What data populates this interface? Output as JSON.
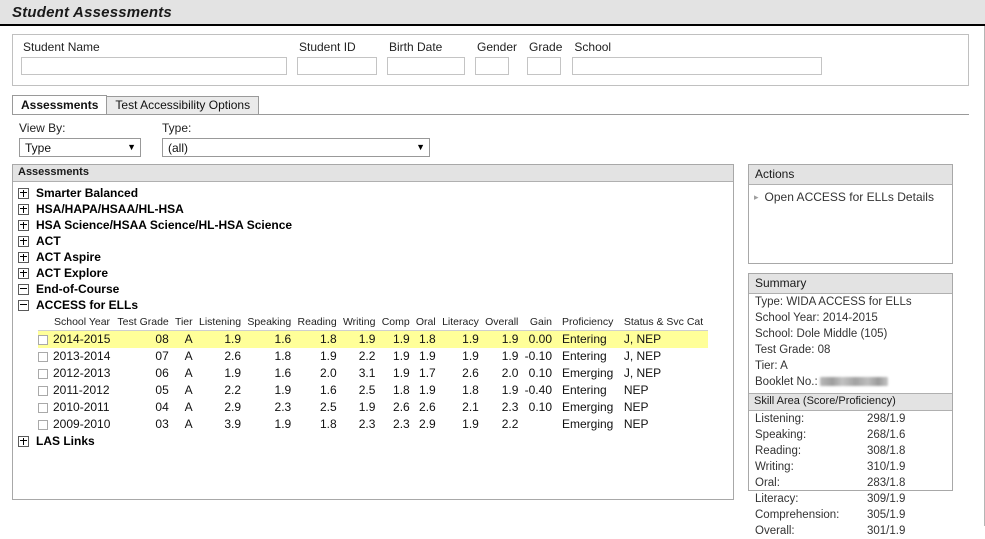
{
  "page_title": "Student Assessments",
  "criteria": {
    "fields": [
      {
        "label": "Student Name",
        "value": "",
        "placeholder": ""
      },
      {
        "label": "Student ID",
        "value": "",
        "placeholder": ""
      },
      {
        "label": "Birth Date",
        "value": "",
        "placeholder": ""
      },
      {
        "label": "Gender",
        "value": "",
        "placeholder": ""
      },
      {
        "label": "Grade",
        "value": "",
        "placeholder": ""
      },
      {
        "label": "School",
        "value": "",
        "placeholder": ""
      }
    ]
  },
  "tabs": [
    {
      "label": "Assessments",
      "active": true
    },
    {
      "label": "Test Accessibility Options",
      "active": false
    }
  ],
  "filters": {
    "view_by_label": "View By:",
    "view_by_value": "Type",
    "type_label": "Type:",
    "type_value": "(all)",
    "caret": "▼"
  },
  "assessments_panel": {
    "header": "Assessments",
    "tree": [
      {
        "label": "Smarter Balanced",
        "expanded": false
      },
      {
        "label": "HSA/HAPA/HSAA/HL-HSA",
        "expanded": false
      },
      {
        "label": "HSA Science/HSAA Science/HL-HSA Science",
        "expanded": false
      },
      {
        "label": "ACT",
        "expanded": false
      },
      {
        "label": "ACT Aspire",
        "expanded": false
      },
      {
        "label": "ACT Explore",
        "expanded": false
      },
      {
        "label": "End-of-Course",
        "expanded": true
      },
      {
        "label": "ACCESS for ELLs",
        "expanded": true
      },
      {
        "label": "LAS Links",
        "expanded": false
      }
    ]
  },
  "scores_table": {
    "columns": [
      "School Year",
      "Test Grade",
      "Tier",
      "Listening",
      "Speaking",
      "Reading",
      "Writing",
      "Comp",
      "Oral",
      "Literacy",
      "Overall",
      "Gain",
      "Proficiency",
      "Status & Svc Cat"
    ],
    "rows": [
      {
        "selected": true,
        "school_year": "2014-2015",
        "test_grade": "08",
        "tier": "A",
        "listening": "1.9",
        "speaking": "1.6",
        "reading": "1.8",
        "writing": "1.9",
        "comp": "1.9",
        "oral": "1.8",
        "literacy": "1.9",
        "overall": "1.9",
        "gain": "0.00",
        "proficiency": "Entering",
        "status_svc_cat": "J, NEP"
      },
      {
        "selected": false,
        "school_year": "2013-2014",
        "test_grade": "07",
        "tier": "A",
        "listening": "2.6",
        "speaking": "1.8",
        "reading": "1.9",
        "writing": "2.2",
        "comp": "1.9",
        "oral": "1.9",
        "literacy": "1.9",
        "overall": "1.9",
        "gain": "-0.10",
        "proficiency": "Entering",
        "status_svc_cat": "J, NEP"
      },
      {
        "selected": false,
        "school_year": "2012-2013",
        "test_grade": "06",
        "tier": "A",
        "listening": "1.9",
        "speaking": "1.6",
        "reading": "2.0",
        "writing": "3.1",
        "comp": "1.9",
        "oral": "1.7",
        "literacy": "2.6",
        "overall": "2.0",
        "gain": "0.10",
        "proficiency": "Emerging",
        "status_svc_cat": "J, NEP"
      },
      {
        "selected": false,
        "school_year": "2011-2012",
        "test_grade": "05",
        "tier": "A",
        "listening": "2.2",
        "speaking": "1.9",
        "reading": "1.6",
        "writing": "2.5",
        "comp": "1.8",
        "oral": "1.9",
        "literacy": "1.8",
        "overall": "1.9",
        "gain": "-0.40",
        "proficiency": "Entering",
        "status_svc_cat": "NEP"
      },
      {
        "selected": false,
        "school_year": "2010-2011",
        "test_grade": "04",
        "tier": "A",
        "listening": "2.9",
        "speaking": "2.3",
        "reading": "2.5",
        "writing": "1.9",
        "comp": "2.6",
        "oral": "2.6",
        "literacy": "2.1",
        "overall": "2.3",
        "gain": "0.10",
        "proficiency": "Emerging",
        "status_svc_cat": "NEP"
      },
      {
        "selected": false,
        "school_year": "2009-2010",
        "test_grade": "03",
        "tier": "A",
        "listening": "3.9",
        "speaking": "1.9",
        "reading": "1.8",
        "writing": "2.3",
        "comp": "2.3",
        "oral": "2.9",
        "literacy": "1.9",
        "overall": "2.2",
        "gain": "",
        "proficiency": "Emerging",
        "status_svc_cat": "NEP"
      }
    ]
  },
  "actions": {
    "header": "Actions",
    "arrow": "▸",
    "items": [
      {
        "label": "Open ACCESS for ELLs Details"
      }
    ]
  },
  "summary": {
    "header": "Summary",
    "lines": [
      {
        "label": "Type:",
        "value": "WIDA ACCESS for ELLs"
      },
      {
        "label": "School Year:",
        "value": "2014-2015"
      },
      {
        "label": "School:",
        "value": "Dole Middle (105)"
      },
      {
        "label": "Test Grade:",
        "value": "08"
      },
      {
        "label": "Tier:",
        "value": "A"
      }
    ],
    "booklet_label": "Booklet No.:",
    "booklet_value_redacted": true,
    "skill_header": "Skill Area (Score/Proficiency)",
    "skills": [
      {
        "name": "Listening:",
        "value": "298/1.9"
      },
      {
        "name": "Speaking:",
        "value": "268/1.6"
      },
      {
        "name": "Reading:",
        "value": "308/1.8"
      },
      {
        "name": "Writing:",
        "value": "310/1.9"
      },
      {
        "name": "Oral:",
        "value": "283/1.8"
      },
      {
        "name": "Literacy:",
        "value": "309/1.9"
      },
      {
        "name": "Comprehension:",
        "value": "305/1.9"
      },
      {
        "name": "Overall:",
        "value": "301/1.9"
      }
    ]
  },
  "colors": {
    "title_band": "#e3e3e3",
    "selected_row": "#ffff99",
    "panel_header": "#e3e3e3",
    "border": "#a8a8a8"
  }
}
